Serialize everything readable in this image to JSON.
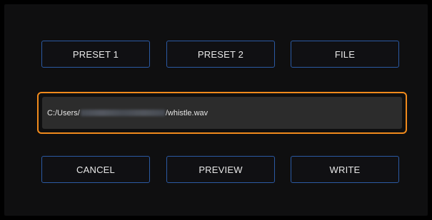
{
  "buttons_top": {
    "preset1": "PRESET 1",
    "preset2": "PRESET 2",
    "file": "FILE"
  },
  "file_path": {
    "prefix": "C:/Users/",
    "suffix": "/whistle.wav"
  },
  "buttons_bottom": {
    "cancel": "CANCEL",
    "preview": "PREVIEW",
    "write": "WRITE"
  },
  "colors": {
    "background": "#000000",
    "panel": "#0f0f10",
    "button_border": "#2b5aa3",
    "path_field_focus_border": "#f08a1c",
    "path_field_bg": "#2c2c2c",
    "text": "#e8e8e8"
  }
}
